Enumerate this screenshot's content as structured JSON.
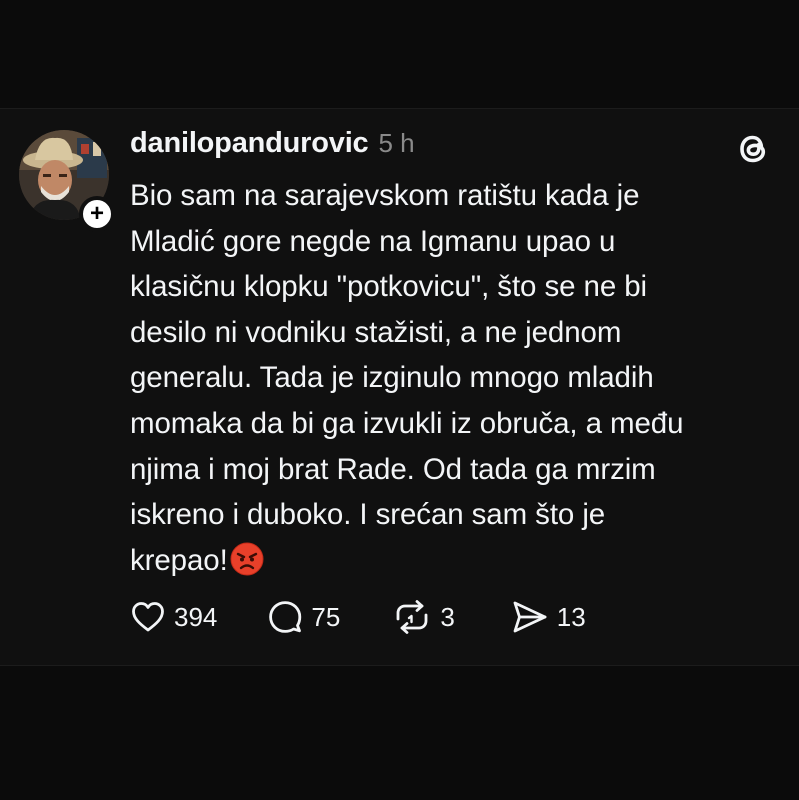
{
  "post": {
    "username": "danilopandurovic",
    "timestamp": "5 h",
    "follow_label": "+",
    "text": "Bio sam na sarajevskom ratištu kada je\nMladić gore negde na Igmanu upao u\nklasičnu klopku \"potkovicu\", što se ne bi\ndesilo ni vodniku stažisti, a ne jednom\ngeneralu. Tada je izginulo mnogo mladih\nmomaka da bi ga izvukli iz obruča, a među\nnjima i moj brat Rade. Od tada ga mrzim\niskreno i duboko. I srećan sam što je\nkrepao!",
    "emoji": "angry-face",
    "stats": {
      "likes": "394",
      "replies": "75",
      "reposts": "3",
      "shares": "13"
    }
  },
  "icons": {
    "like": "heart-icon",
    "reply": "comment-bubble-icon",
    "repost": "repost-arrows-icon",
    "share": "send-paper-plane-icon",
    "brand": "threads-logo-icon"
  },
  "colors": {
    "background": "#0b0b0b",
    "card": "#101010",
    "text": "#f3f5f7",
    "muted": "#8a8a8a",
    "emoji": "#e8402a"
  }
}
